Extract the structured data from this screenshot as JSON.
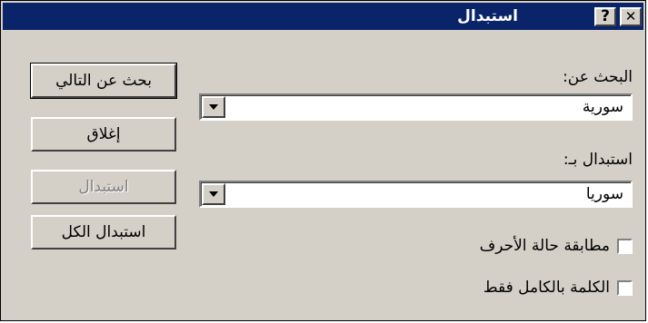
{
  "window": {
    "title": "استبدال",
    "help_glyph": "?",
    "close_glyph": "✕"
  },
  "find": {
    "label": "البحث عن:",
    "value": "سورية"
  },
  "replace": {
    "label": "استبدال بـ:",
    "value": "سوريا"
  },
  "options": {
    "match_case": "مطابقة حالة الأحرف",
    "whole_word": "الكلمة بالكامل فقط"
  },
  "buttons": {
    "find_next": "بحث عن التالي",
    "close": "إغلاق",
    "replace": "استبدال",
    "replace_all": "استبدال الكل"
  }
}
